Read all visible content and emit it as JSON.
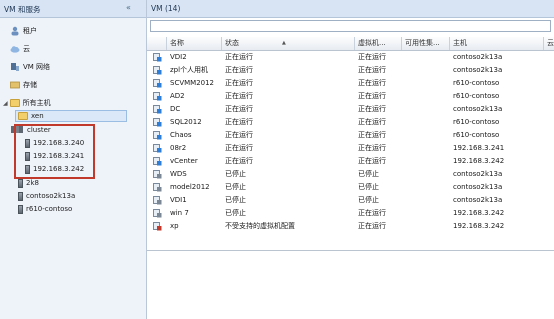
{
  "nav": {
    "title": "VM 和服务",
    "chevron": "«",
    "items": [
      {
        "label": "租户"
      },
      {
        "label": "云"
      },
      {
        "label": "VM 网络"
      },
      {
        "label": "存储"
      },
      {
        "label": "所有主机"
      }
    ]
  },
  "tree": {
    "xen": "xen",
    "cluster": "cluster",
    "cluster_hosts": [
      "192.168.3.240",
      "192.168.3.241",
      "192.168.3.242"
    ],
    "other_hosts": [
      "2k8",
      "contoso2k13a",
      "r610-contoso"
    ]
  },
  "main": {
    "title": "VM (14)",
    "search_placeholder": "",
    "columns": [
      "名称",
      "状态",
      "虚拟机...",
      "可用性集...",
      "主机",
      "云"
    ],
    "rows": [
      {
        "name": "VDI2",
        "status": "正在运行",
        "vm_state": "正在运行",
        "availability": "",
        "host": "contoso2k13a"
      },
      {
        "name": "zpl个人用机",
        "status": "正在运行",
        "vm_state": "正在运行",
        "availability": "",
        "host": "contoso2k13a"
      },
      {
        "name": "SCVMM2012",
        "status": "正在运行",
        "vm_state": "正在运行",
        "availability": "",
        "host": "r610-contoso"
      },
      {
        "name": "AD2",
        "status": "正在运行",
        "vm_state": "正在运行",
        "availability": "",
        "host": "r610-contoso"
      },
      {
        "name": "DC",
        "status": "正在运行",
        "vm_state": "正在运行",
        "availability": "",
        "host": "contoso2k13a"
      },
      {
        "name": "SQL2012",
        "status": "正在运行",
        "vm_state": "正在运行",
        "availability": "",
        "host": "r610-contoso"
      },
      {
        "name": "Chaos",
        "status": "正在运行",
        "vm_state": "正在运行",
        "availability": "",
        "host": "r610-contoso"
      },
      {
        "name": "08r2",
        "status": "正在运行",
        "vm_state": "正在运行",
        "availability": "",
        "host": "192.168.3.241"
      },
      {
        "name": "vCenter",
        "status": "正在运行",
        "vm_state": "正在运行",
        "availability": "",
        "host": "192.168.3.242"
      },
      {
        "name": "WDS",
        "status": "已停止",
        "vm_state": "已停止",
        "availability": "",
        "host": "contoso2k13a"
      },
      {
        "name": "model2012",
        "status": "已停止",
        "vm_state": "已停止",
        "availability": "",
        "host": "contoso2k13a"
      },
      {
        "name": "VDI1",
        "status": "已停止",
        "vm_state": "已停止",
        "availability": "",
        "host": "contoso2k13a"
      },
      {
        "name": "win 7",
        "status": "已停止",
        "vm_state": "正在运行",
        "availability": "",
        "host": "192.168.3.242"
      },
      {
        "name": "xp",
        "status": "不受支持的虚拟机配置",
        "vm_state": "正在运行",
        "availability": "",
        "host": "192.168.3.242"
      }
    ]
  },
  "colors": {
    "header_bg": "#d8e4f3",
    "nav_bg": "#eef3fa",
    "annotation_border": "#c0392b",
    "selected_bg": "#dbe8f8"
  }
}
